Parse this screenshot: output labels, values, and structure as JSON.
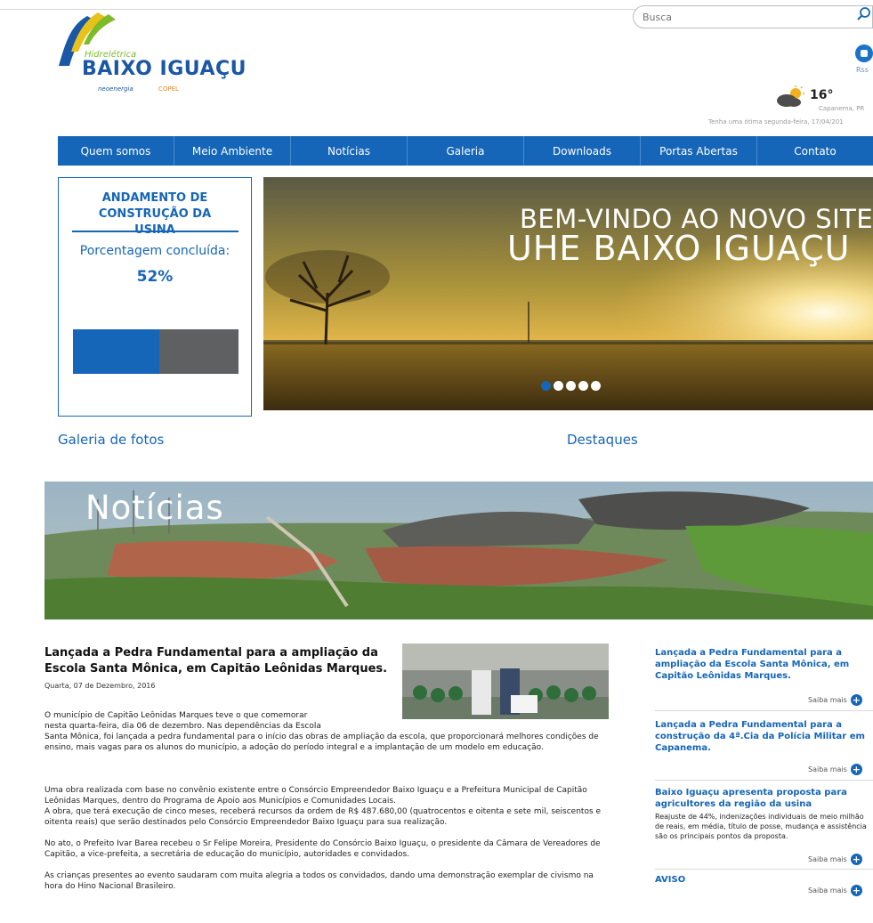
{
  "header": {
    "search_placeholder": "Busca",
    "rss_label": "Rss",
    "temperature": "16°",
    "city": "Capanema, PR",
    "greeting": "Tenha uma ótima segunda-feira, 17/04/201",
    "logo_subtitle": "Hidrelétrica",
    "logo_title": "BAIXO IGUAÇU",
    "partner1": "neoenergia",
    "partner2": "COPEL"
  },
  "nav": [
    "Quem somos",
    "Meio Ambiente",
    "Notícias",
    "Galeria",
    "Downloads",
    "Portas Abertas",
    "Contato"
  ],
  "progress": {
    "title": "ANDAMENTO DE CONSTRUÇÃO DA USINA",
    "label": "Porcentagem concluída:",
    "value_text": "52%",
    "fraction": 0.52
  },
  "hero": {
    "line1": "BEM-VINDO AO NOVO SITE",
    "line2": "UHE BAIXO IGUAÇU",
    "slides": 5,
    "active_slide": 0
  },
  "sections": {
    "gallery": "Galeria de fotos",
    "highlights": "Destaques",
    "news_banner": "Notícias"
  },
  "article": {
    "title": "Lançada a Pedra Fundamental para a ampliação da Escola Santa Mônica, em Capitão Leônidas Marques.",
    "date": "Quarta, 07 de Dezembro, 2016",
    "p1a": "O município de Capitão Leônidas Marques teve o que comemorar",
    "p1b": "nesta quarta-feira, dia 06 de dezembro. Nas dependências da Escola",
    "p1c": "Santa Mônica, foi lançada a pedra fundamental para o início das obras de ampliação da escola, que proporcionará melhores condições de ensino, mais vagas para os alunos do município, a adoção do período integral e a implantação de um modelo em educação.",
    "p2": "Uma obra realizada com base no convênio existente entre o Consórcio Empreendedor Baixo Iguaçu e a Prefeitura Municipal de Capitão Leônidas Marques, dentro do Programa de Apoio aos Municípios e Comunidades Locais.",
    "p3": "A obra, que terá execução de cinco meses, receberá recursos da ordem de R$ 487.680,00 (quatrocentos e oitenta e sete mil, seiscentos e oitenta reais) que serão destinados pelo Consórcio Empreendedor Baixo Iguaçu para sua realização.",
    "p4": "No ato, o Prefeito Ivar Barea recebeu o Sr Felipe Moreira, Presidente do Consórcio Baixo Iguaçu, o presidente da Câmara de Vereadores de Capitão, a vice-prefeita, a secretária de educação do município, autoridades e convidados.",
    "p5": "As crianças presentes ao evento saudaram com muita alegria a todos os convidados, dando uma demonstração exemplar de civismo na hora do Hino Nacional Brasileiro."
  },
  "sidebar": {
    "more_label": "Saiba mais",
    "items": [
      {
        "title": "Lançada a Pedra Fundamental para a ampliação da Escola Santa Mônica, em Capitão Leônidas Marques.",
        "desc": ""
      },
      {
        "title": "Lançada a Pedra Fundamental para a construção da 4ª.Cia da Polícia Militar em Capanema.",
        "desc": ""
      },
      {
        "title": "Baixo Iguaçu apresenta proposta para agricultores da região da usina",
        "desc": "Reajuste de 44%, indenizações individuais de meio milhão de reais, em média, título de posse, mudança e assistência são os principais pontos da proposta."
      },
      {
        "title": "AVISO",
        "desc": ""
      }
    ]
  },
  "colors": {
    "brand_blue": "#1565b8",
    "bar_gray": "#5f6062",
    "logo_green": "#7dbb2a"
  }
}
